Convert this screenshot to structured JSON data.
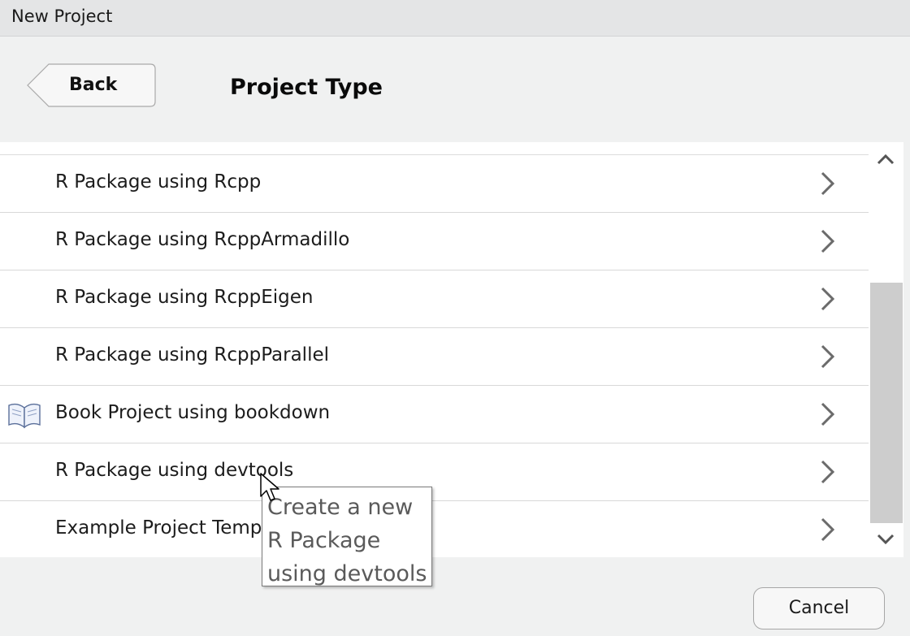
{
  "window": {
    "title": "New Project"
  },
  "header": {
    "back_label": "Back",
    "title": "Project Type"
  },
  "project_types": [
    {
      "label": "R Package using Rcpp",
      "icon": "none"
    },
    {
      "label": "R Package using RcppArmadillo",
      "icon": "none"
    },
    {
      "label": "R Package using RcppEigen",
      "icon": "none"
    },
    {
      "label": "R Package using RcppParallel",
      "icon": "none"
    },
    {
      "label": "Book Project using bookdown",
      "icon": "book-icon"
    },
    {
      "label": "R Package using devtools",
      "icon": "none"
    },
    {
      "label": "Example Project Template",
      "icon": "none"
    }
  ],
  "tooltip": {
    "text": "Create a new R Package using devtools"
  },
  "footer": {
    "cancel_label": "Cancel"
  },
  "colors": {
    "background": "#f0f1f1",
    "list_background": "#ffffff",
    "scroll_thumb": "#cdcdcd"
  }
}
